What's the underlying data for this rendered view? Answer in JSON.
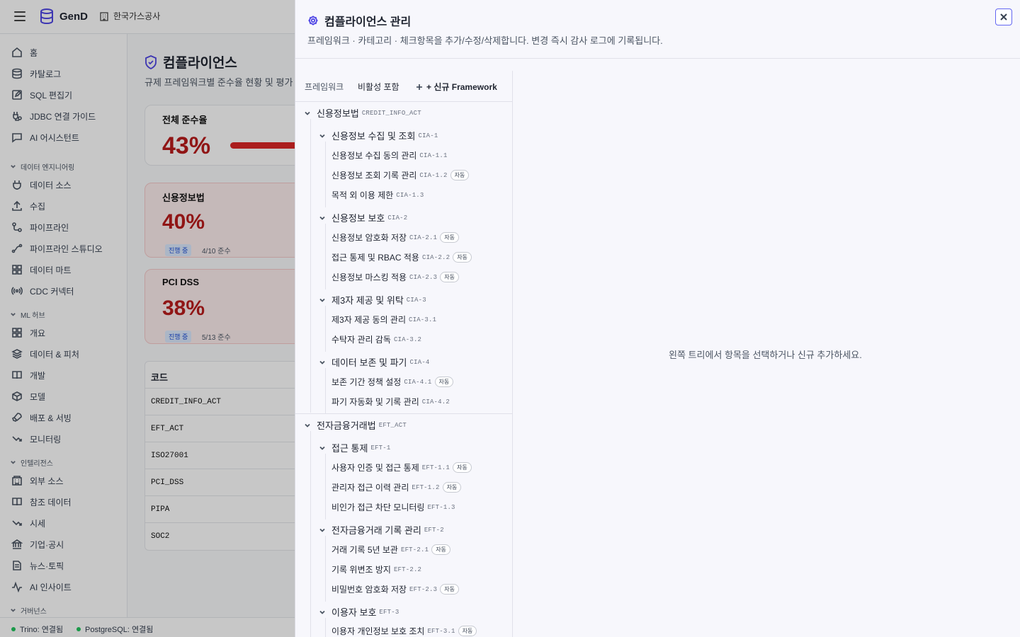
{
  "app": {
    "brand": "GenD",
    "org": "한국가스공사"
  },
  "sidebar": {
    "top_items": [
      {
        "label": "홈",
        "icon": "home-icon"
      },
      {
        "label": "카탈로그",
        "icon": "database-icon"
      },
      {
        "label": "SQL 편집기",
        "icon": "edit-icon"
      },
      {
        "label": "JDBC 연결 가이드",
        "icon": "plug-icon"
      },
      {
        "label": "AI 어시스턴트",
        "icon": "chat-icon"
      }
    ],
    "groups": [
      {
        "label": "데이터 엔지니어링",
        "items": [
          "데이터 소스",
          "수집",
          "파이프라인",
          "파이프라인 스튜디오",
          "데이터 마트",
          "CDC 커넥터"
        ]
      },
      {
        "label": "ML 허브",
        "items": [
          "개요",
          "데이터 & 피처",
          "개발",
          "모델",
          "배포 & 서빙",
          "모니터링"
        ]
      },
      {
        "label": "인텔리전스",
        "items": [
          "외부 소스",
          "참조 데이터",
          "시세",
          "기업·공시",
          "뉴스·토픽",
          "AI 인사이트"
        ]
      },
      {
        "label": "거버넌스",
        "items": []
      }
    ]
  },
  "status": {
    "trino": "Trino: 연결됨",
    "postgres": "PostgreSQL: 연결됨"
  },
  "page": {
    "title": "컴플라이언스",
    "subtitle": "규제 프레임워크별 준수율 현황 및 평가",
    "cards": [
      {
        "title": "전체 준수율",
        "pct": "43%",
        "progress": 0.43
      },
      {
        "title": "신용정보법",
        "pct": "40%",
        "badge": "진행 중",
        "count": "4/10 준수"
      },
      {
        "title": "PCI DSS",
        "pct": "38%",
        "badge": "진행 중",
        "count": "5/13 준수"
      }
    ],
    "table": {
      "header": "코드",
      "rows": [
        "CREDIT_INFO_ACT",
        "EFT_ACT",
        "ISO27001",
        "PCI_DSS",
        "PIPA",
        "SOC2"
      ]
    }
  },
  "panel": {
    "title": "컴플라이언스 관리",
    "description": "프레임워크 · 카테고리 · 체크항목을 추가/수정/삭제합니다. 변경 즉시 감사 로그에 기록됩니다.",
    "toolbar": {
      "label": "프레임워크",
      "toggle": "비활성 포함",
      "new_button": "+ 신규 Framework"
    },
    "empty_message": "왼쪽 트리에서 항목을 선택하거나 신규 추가하세요.",
    "auto_badge": "자동",
    "frameworks": [
      {
        "name": "신용정보법",
        "code": "CREDIT_INFO_ACT",
        "categories": [
          {
            "name": "신용정보 수집 및 조회",
            "code": "CIA-1",
            "items": [
              {
                "name": "신용정보 수집 동의 관리",
                "code": "CIA-1.1",
                "auto": false
              },
              {
                "name": "신용정보 조회 기록 관리",
                "code": "CIA-1.2",
                "auto": true
              },
              {
                "name": "목적 외 이용 제한",
                "code": "CIA-1.3",
                "auto": false
              }
            ]
          },
          {
            "name": "신용정보 보호",
            "code": "CIA-2",
            "items": [
              {
                "name": "신용정보 암호화 저장",
                "code": "CIA-2.1",
                "auto": true
              },
              {
                "name": "접근 통제 및 RBAC 적용",
                "code": "CIA-2.2",
                "auto": true
              },
              {
                "name": "신용정보 마스킹 적용",
                "code": "CIA-2.3",
                "auto": true
              }
            ]
          },
          {
            "name": "제3자 제공 및 위탁",
            "code": "CIA-3",
            "items": [
              {
                "name": "제3자 제공 동의 관리",
                "code": "CIA-3.1",
                "auto": false
              },
              {
                "name": "수탁자 관리 감독",
                "code": "CIA-3.2",
                "auto": false
              }
            ]
          },
          {
            "name": "데이터 보존 및 파기",
            "code": "CIA-4",
            "items": [
              {
                "name": "보존 기간 정책 설정",
                "code": "CIA-4.1",
                "auto": true
              },
              {
                "name": "파기 자동화 및 기록 관리",
                "code": "CIA-4.2",
                "auto": false
              }
            ]
          }
        ]
      },
      {
        "name": "전자금융거래법",
        "code": "EFT_ACT",
        "categories": [
          {
            "name": "접근 통제",
            "code": "EFT-1",
            "items": [
              {
                "name": "사용자 인증 및 접근 통제",
                "code": "EFT-1.1",
                "auto": true
              },
              {
                "name": "관리자 접근 이력 관리",
                "code": "EFT-1.2",
                "auto": true
              },
              {
                "name": "비인가 접근 차단 모니터링",
                "code": "EFT-1.3",
                "auto": false
              }
            ]
          },
          {
            "name": "전자금융거래 기록 관리",
            "code": "EFT-2",
            "items": [
              {
                "name": "거래 기록 5년 보관",
                "code": "EFT-2.1",
                "auto": true
              },
              {
                "name": "기록 위변조 방지",
                "code": "EFT-2.2",
                "auto": false
              },
              {
                "name": "비밀번호 암호화 저장",
                "code": "EFT-2.3",
                "auto": true
              }
            ]
          },
          {
            "name": "이용자 보호",
            "code": "EFT-3",
            "items": [
              {
                "name": "이용자 개인정보 보호 조치",
                "code": "EFT-3.1",
                "auto": true
              }
            ]
          }
        ]
      }
    ]
  }
}
